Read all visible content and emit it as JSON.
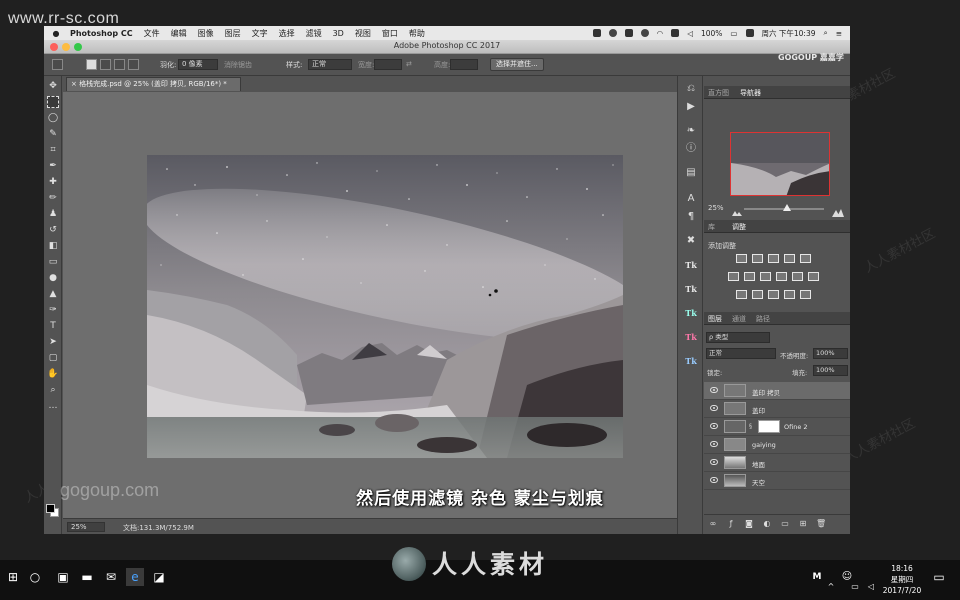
{
  "site_watermark": "www.rr-sc.com",
  "menubar": {
    "app": "Photoshop CC",
    "items": [
      "文件",
      "编辑",
      "图像",
      "图层",
      "文字",
      "选择",
      "滤镜",
      "3D",
      "视图",
      "窗口",
      "帮助"
    ],
    "battery": "100%",
    "clock": "周六 下午10:39"
  },
  "titlebar": {
    "title": "Adobe Photoshop CC 2017"
  },
  "options": {
    "feather_label": "羽化:",
    "feather_value": "0 像素",
    "antialias": "消除锯齿",
    "style_label": "样式:",
    "style_value": "正常",
    "width_label": "宽度:",
    "height_label": "高度:",
    "select_mask_btn": "选择并遮住..."
  },
  "document": {
    "tab": "格栈完成.psd @ 25% (盖印 拷贝, RGB/16*) *",
    "zoom": "25%",
    "docsize": "文档:131.3M/752.9M"
  },
  "navigator": {
    "tabs": [
      "直方图",
      "导航器"
    ],
    "zoom": "25%"
  },
  "adjustments": {
    "tabs": [
      "库",
      "调整"
    ],
    "add_label": "添加调整"
  },
  "layers": {
    "tabs": [
      "图层",
      "通道",
      "路径"
    ],
    "filter": "ρ 类型",
    "blend_mode": "正常",
    "opacity_label": "不透明度:",
    "opacity": "100%",
    "lock_label": "锁定:",
    "fill_label": "填充:",
    "fill": "100%",
    "items": [
      {
        "name": "盖印 拷贝",
        "selected": true,
        "mask": false
      },
      {
        "name": "盖印",
        "selected": false,
        "mask": false
      },
      {
        "name": "Ofine 2",
        "selected": false,
        "mask": true
      },
      {
        "name": "gaiying",
        "selected": false,
        "mask": false
      },
      {
        "name": "地面",
        "selected": false,
        "mask": false
      },
      {
        "name": "天空",
        "selected": false,
        "mask": false
      }
    ]
  },
  "caption": "然后使用滤镜 杂色 蒙尘与划痕",
  "gogoup_watermark": "gogoup.com",
  "gogoup_logo": "GOGOUP 嘉嘉学",
  "diagonal_watermark": "人人素材社区",
  "taskbar": {
    "time": "18:16",
    "weekday": "星期四",
    "date": "2017/7/20",
    "ime": "M"
  },
  "brand": "人人素材",
  "colors": {
    "menubar": "#e8e8e8",
    "panel": "#535353",
    "canvas_bg": "#6e6e6e",
    "taskbar": "#101010",
    "nav_frame": "#dd3333"
  }
}
